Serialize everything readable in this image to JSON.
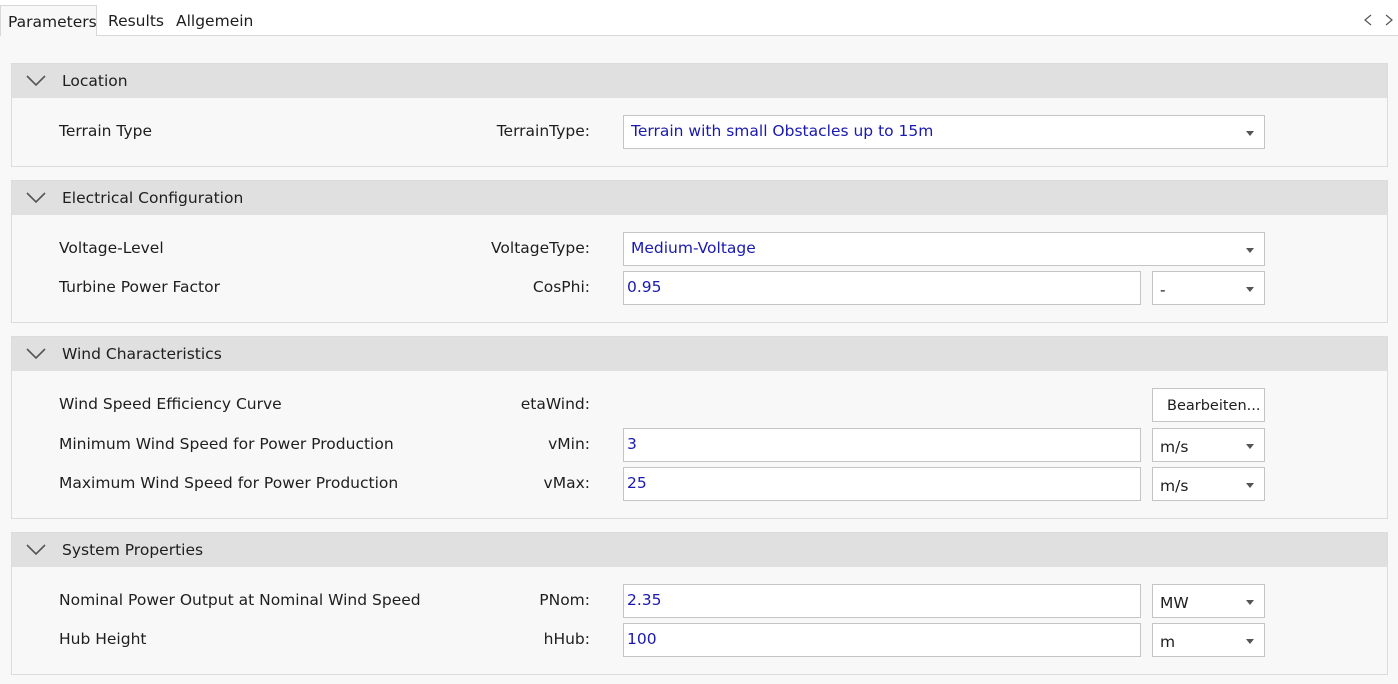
{
  "tabs": [
    {
      "label": "Parameters"
    },
    {
      "label": "Results"
    },
    {
      "label": "Allgemein"
    }
  ],
  "sections": {
    "location": {
      "title": "Location",
      "terrain": {
        "label": "Terrain Type",
        "prop": "TerrainType:",
        "value": "Terrain with small Obstacles up to 15m"
      }
    },
    "electrical": {
      "title": "Electrical Configuration",
      "voltage": {
        "label": "Voltage-Level",
        "prop": "VoltageType:",
        "value": "Medium-Voltage"
      },
      "cosphi": {
        "label": "Turbine Power Factor",
        "prop": "CosPhi:",
        "value": "0.95",
        "unit": "-"
      }
    },
    "wind": {
      "title": "Wind Characteristics",
      "etawind": {
        "label": "Wind Speed Efficiency Curve",
        "prop": "etaWind:",
        "button": "Bearbeiten..."
      },
      "vmin": {
        "label": "Minimum Wind Speed for Power Production",
        "prop": "vMin:",
        "value": "3",
        "unit": "m/s"
      },
      "vmax": {
        "label": "Maximum Wind Speed for Power Production",
        "prop": "vMax:",
        "value": "25",
        "unit": "m/s"
      }
    },
    "system": {
      "title": "System Properties",
      "pnom": {
        "label": "Nominal Power Output at Nominal Wind Speed",
        "prop": "PNom:",
        "value": "2.35",
        "unit": "MW"
      },
      "hhub": {
        "label": "Hub Height",
        "prop": "hHub:",
        "value": "100",
        "unit": "m"
      }
    }
  },
  "colors": {
    "value_text": "#1a1ab0",
    "header_bg": "#e0e0e0"
  }
}
